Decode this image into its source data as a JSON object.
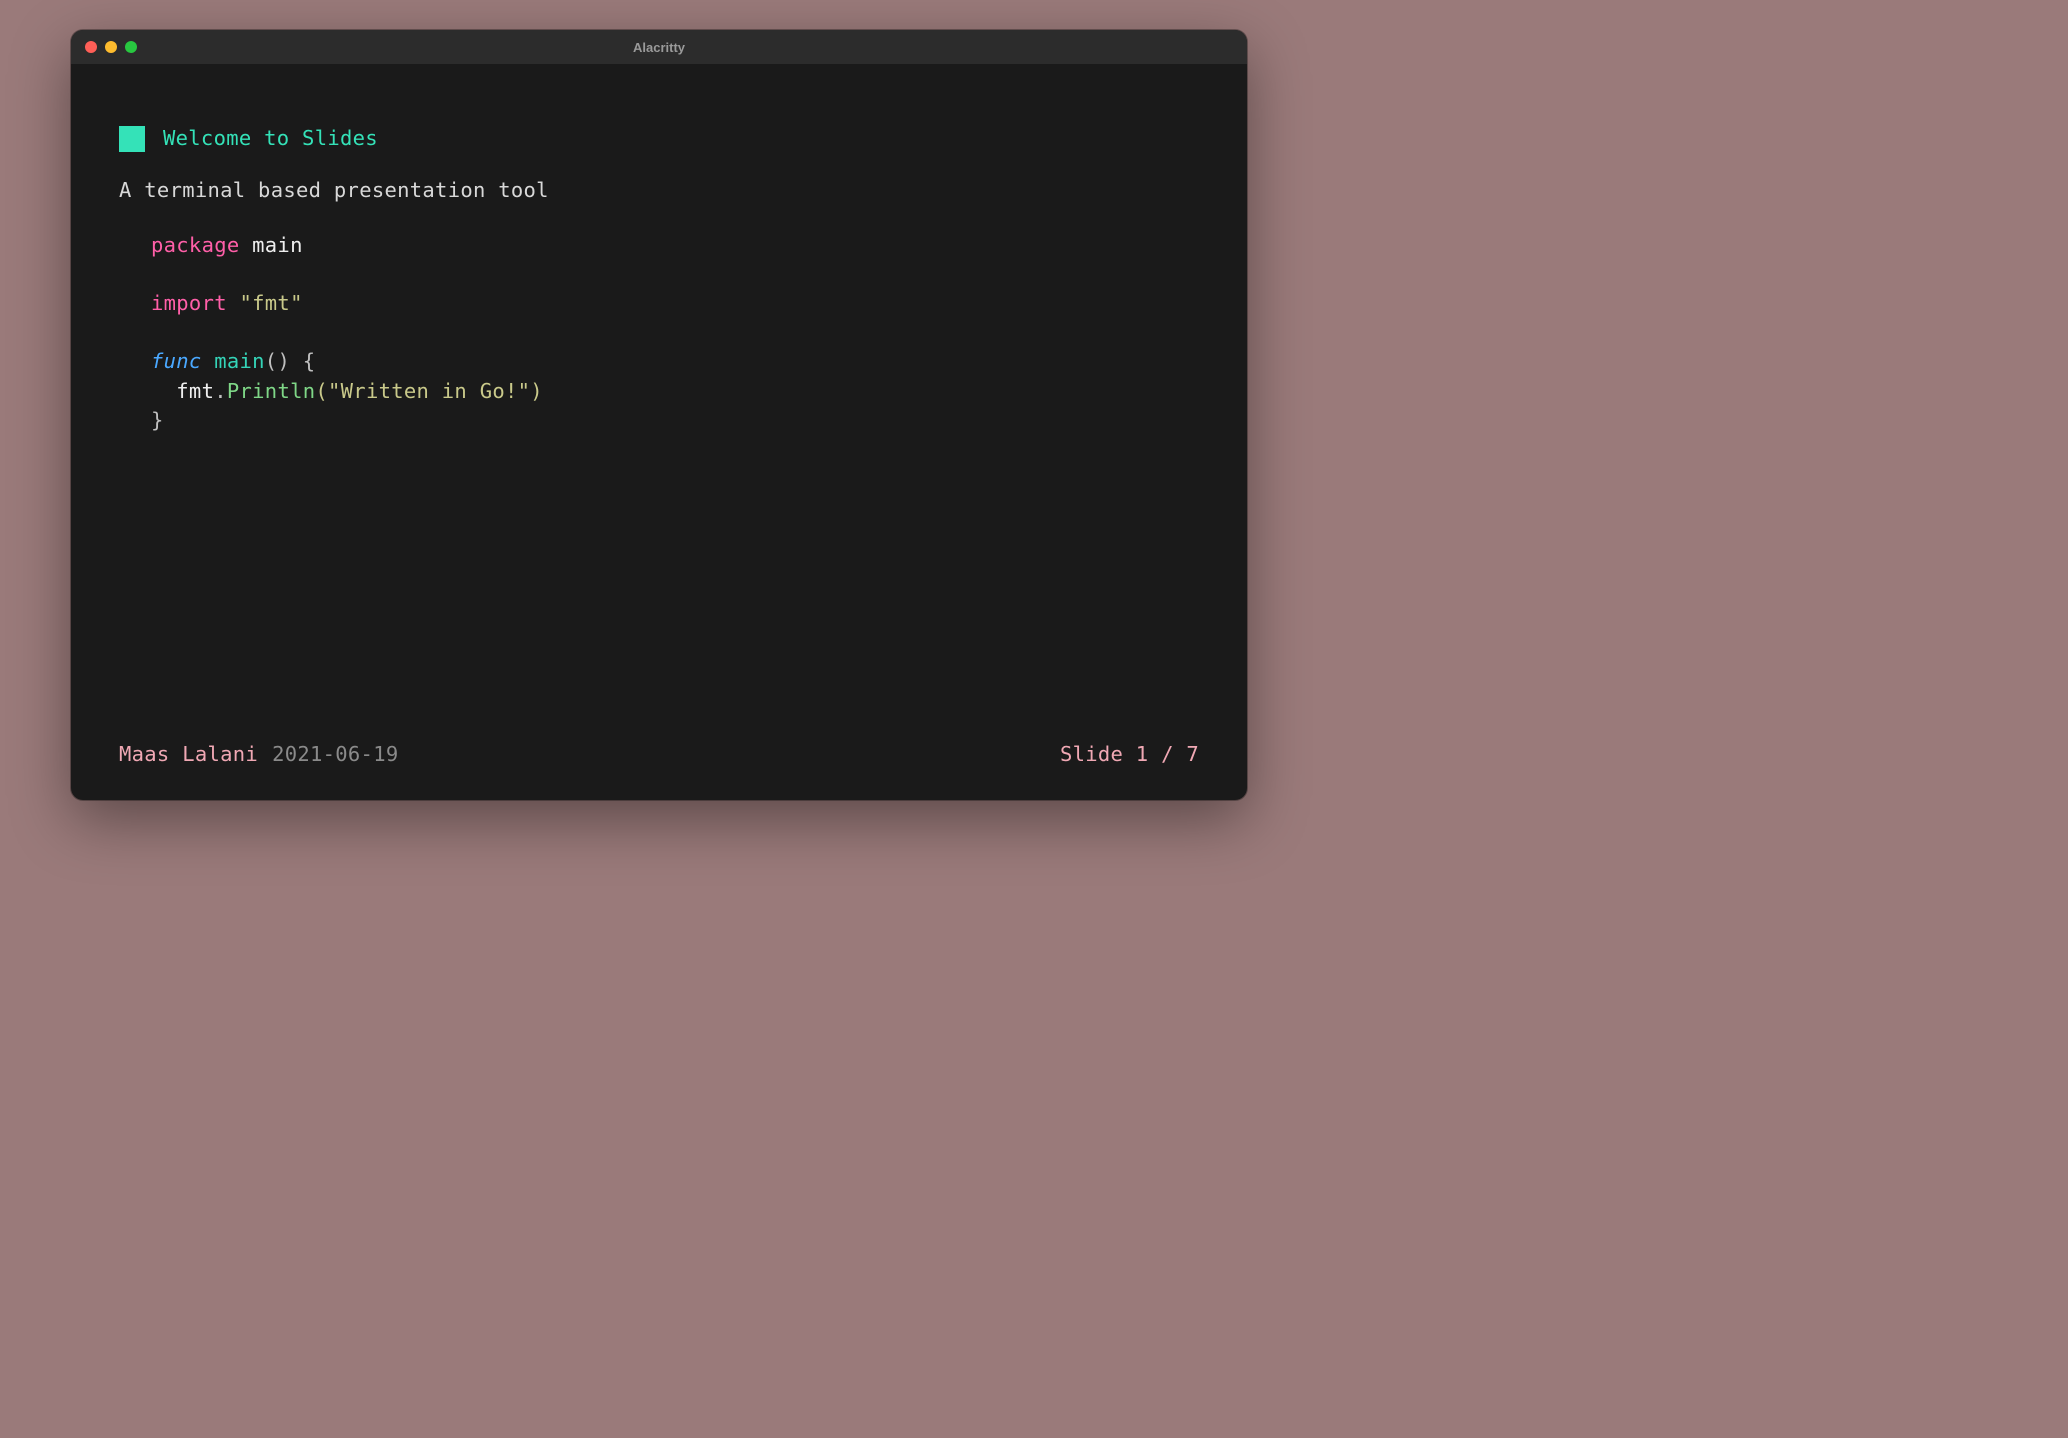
{
  "window": {
    "title": "Alacritty"
  },
  "slide": {
    "heading": "Welcome to Slides",
    "subtitle": "A terminal based presentation tool"
  },
  "code": {
    "l1_kw": "package",
    "l1_name": " main",
    "l2_kw": "import",
    "l2_str": " \"fmt\"",
    "l3_func": "func",
    "l3_name": " main",
    "l3_paren": "() {",
    "l4_indent": "  fmt",
    "l4_dot": ".",
    "l4_call": "Println",
    "l4_args": "(\"Written in Go!\")",
    "l5": "}"
  },
  "footer": {
    "author": "Maas Lalani",
    "date": "2021-06-19",
    "position": "Slide 1 / 7"
  }
}
